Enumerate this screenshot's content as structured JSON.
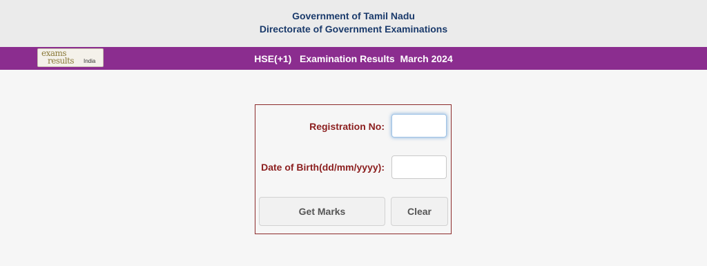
{
  "header": {
    "line1": "Government of Tamil Nadu",
    "line2": "Directorate of Government Examinations"
  },
  "banner": {
    "logo": {
      "word1": "exams",
      "word2": "results",
      "word3": "India"
    },
    "title": "HSE(+1)   Examination Results  March 2024",
    "background_color": "#8b2d8f"
  },
  "form": {
    "registration_label": "Registration No:",
    "registration_value": "",
    "dob_label": "Date of Birth(dd/mm/yyyy):",
    "dob_value": "",
    "get_marks_label": "Get Marks",
    "clear_label": "Clear",
    "label_color": "#8b1e1e",
    "border_color": "#8b2a2a"
  }
}
